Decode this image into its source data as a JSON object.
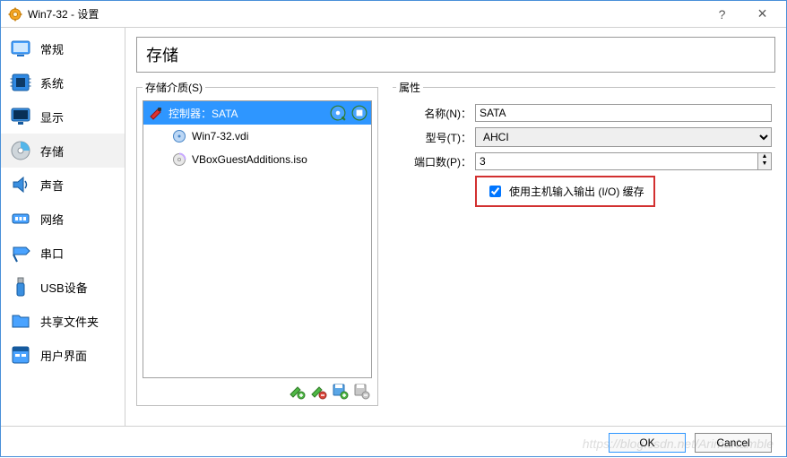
{
  "window": {
    "title": "Win7-32 - 设置",
    "help": "?",
    "close": "×"
  },
  "sidebar": {
    "items": [
      {
        "label": "常规"
      },
      {
        "label": "系统"
      },
      {
        "label": "显示"
      },
      {
        "label": "存储"
      },
      {
        "label": "声音"
      },
      {
        "label": "网络"
      },
      {
        "label": "串口"
      },
      {
        "label": "USB设备"
      },
      {
        "label": "共享文件夹"
      },
      {
        "label": "用户界面"
      }
    ]
  },
  "page": {
    "title": "存储"
  },
  "tree": {
    "legend": "存储介质(S)",
    "controller": {
      "label": "控制器：SATA"
    },
    "items": [
      {
        "label": "Win7-32.vdi"
      },
      {
        "label": "VBoxGuestAdditions.iso"
      }
    ]
  },
  "attrs": {
    "legend": "属性",
    "name_label": "名称(N)：",
    "name_value": "SATA",
    "model_label": "型号(T)：",
    "model_value": "AHCI",
    "ports_label": "端口数(P)：",
    "ports_value": "3",
    "io_cache_label": "使用主机输入输出 (I/O) 缓存"
  },
  "buttons": {
    "ok": "OK",
    "cancel": "Cancel"
  },
  "watermark": "https://blog.csdn.net/ArimaKamble"
}
